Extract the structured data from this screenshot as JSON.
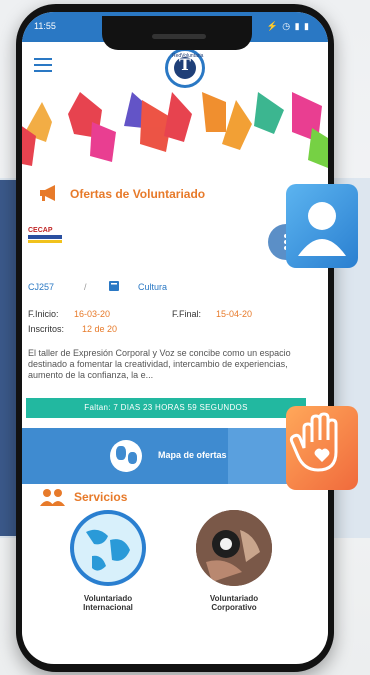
{
  "statusbar": {
    "time": "11:55",
    "right": "⚡ ◷ ▮ ▮"
  },
  "app": {
    "logo_text": "T",
    "logo_small": "RedVoluntaria"
  },
  "colors": {
    "primary": "#2a78c4",
    "accent": "#e77a2a",
    "teal": "#22b8a0",
    "dark_blue": "#1f3f78"
  },
  "offers": {
    "section_title": "Ofertas de Voluntariado",
    "org_logo_text": "CECAP",
    "code": "CJ257",
    "separator": "/",
    "category": "Cultura",
    "start_label": "F.Inicio:",
    "start_value": "16-03-20",
    "end_label": "F.Final:",
    "end_value": "15-04-20",
    "enrolled_label": "Inscritos:",
    "enrolled_value": "12 de 20",
    "description": "El taller de Expresión Corporal y Voz se concibe como un espacio destinado a fomentar la creatividad, intercambio de experiencias, aumento de la confianza, la e...",
    "countdown": "Faltan: 7 DIAS 23 HORAS 59 SEGUNDOS"
  },
  "map_button": {
    "label": "Mapa de ofertas"
  },
  "services": {
    "section_title": "Servicios",
    "items": [
      {
        "label_line1": "Voluntariado",
        "label_line2": "Internacional"
      },
      {
        "label_line1": "Voluntariado",
        "label_line2": "Corporativo"
      }
    ]
  },
  "icons": [
    "hamburger-icon",
    "megaphone-icon",
    "more-options-icon",
    "book-icon",
    "globe-icon",
    "people-icon",
    "user-icon",
    "hand-heart-icon"
  ]
}
